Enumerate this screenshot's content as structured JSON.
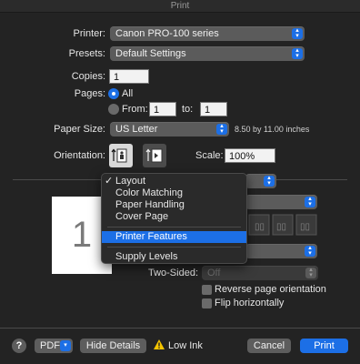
{
  "window": {
    "title": "Print"
  },
  "printer": {
    "label": "Printer:",
    "value": "Canon PRO-100 series"
  },
  "presets": {
    "label": "Presets:",
    "value": "Default Settings"
  },
  "copies": {
    "label": "Copies:",
    "value": "1"
  },
  "pages": {
    "label": "Pages:",
    "all_label": "All",
    "from_label": "From:",
    "from_value": "1",
    "to_label": "to:",
    "to_value": "1",
    "selected": "All"
  },
  "paper_size": {
    "label": "Paper Size:",
    "value": "US Letter",
    "dimensions": "8.50 by 11.00 inches"
  },
  "orientation": {
    "label": "Orientation:",
    "selected": "portrait"
  },
  "scale": {
    "label": "Scale:",
    "value": "100%"
  },
  "preview": {
    "page_number": "1"
  },
  "section_menu": {
    "items": [
      {
        "label": "Layout",
        "checked": true
      },
      {
        "label": "Color Matching"
      },
      {
        "label": "Paper Handling"
      },
      {
        "label": "Cover Page"
      },
      {
        "label": "Printer Features",
        "highlighted": true
      },
      {
        "label": "Supply Levels"
      }
    ],
    "check_glyph": "✓"
  },
  "two_sided": {
    "label": "Two-Sided:",
    "value": "Off"
  },
  "reverse_orientation": {
    "label": "Reverse page orientation",
    "checked": false
  },
  "flip_horizontally": {
    "label": "Flip horizontally",
    "checked": false
  },
  "footer": {
    "help_label": "?",
    "pdf_label": "PDF",
    "hide_details_label": "Hide Details",
    "low_ink_label": "Low Ink",
    "cancel_label": "Cancel",
    "print_label": "Print"
  },
  "colors": {
    "accent": "#1c6fe6",
    "warning": "#f5c400",
    "background": "#232323"
  },
  "icons": [
    "up-down-arrows-icon",
    "checkmark-icon",
    "warning-triangle-icon",
    "portrait-orientation-icon",
    "landscape-orientation-icon",
    "layout-direction-icon"
  ]
}
